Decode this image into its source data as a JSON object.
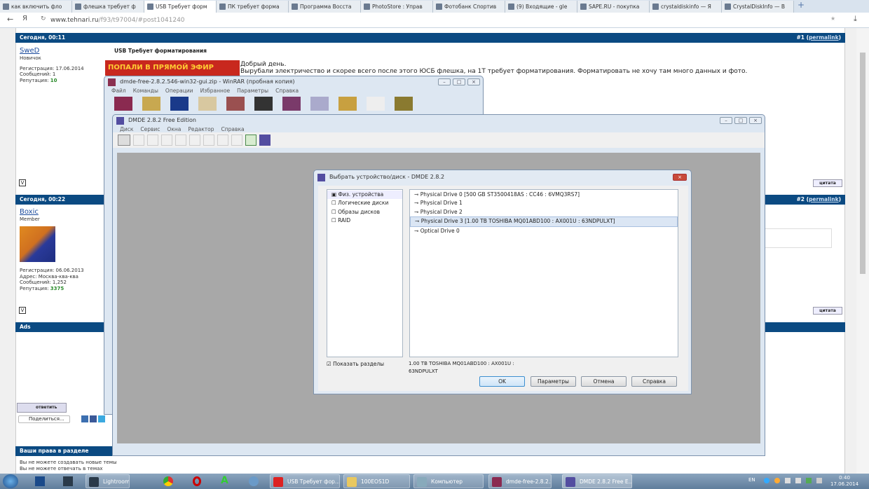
{
  "browser": {
    "tabs": [
      {
        "label": "как включить фло"
      },
      {
        "label": "флешка требует ф"
      },
      {
        "label": "USB Требует форм",
        "active": true
      },
      {
        "label": "ПК требует форма"
      },
      {
        "label": "Программа Восста"
      },
      {
        "label": "PhotoStore : Управ"
      },
      {
        "label": "Фотобанк Спортив"
      },
      {
        "label": "(9) Входящие - gle"
      },
      {
        "label": "SAPE.RU - покупка"
      },
      {
        "label": "crystaldiskinfo — Я"
      },
      {
        "label": "CrystalDiskInfo — В"
      }
    ],
    "url_host": "www.tehnari.ru",
    "url_path": "/f93/t97004/#post1041240"
  },
  "forum": {
    "post1": {
      "date": "Сегодня, 00:11",
      "number": "#1",
      "permalink": "permalink",
      "user": "SweD",
      "rank": "Новичок",
      "reg": "Регистрация: 17.06.2014",
      "posts": "Сообщений: 1",
      "rep_label": "Репутация:",
      "rep": "10",
      "title": "USB Требует форматирования",
      "banner": "ПОПАЛИ В ПРЯМОЙ ЭФИР",
      "text1": "Добрый день.",
      "text2": "Вырубали электричество и скорее всего после этого ЮСБ флешка, на 1Т требует форматирования. Форматировать не хочу там много данных и фото.",
      "quote": "цитата"
    },
    "post2": {
      "date": "Сегодня, 00:22",
      "number": "#2",
      "permalink": "permalink",
      "user": "Boxic",
      "rank": "Member",
      "reg": "Регистрация: 06.06.2013",
      "addr": "Адрес: Москва-ква-ква",
      "posts": "Сообщений: 1,252",
      "rep_label": "Репутация:",
      "rep": "3375",
      "quote": "цитата"
    },
    "ads": "Ads",
    "reply": "ответить",
    "share": "Поделиться...",
    "rights_title": "Ваши права в разделе",
    "rights": [
      "Вы не можете создавать новые темы",
      "Вы не можете отвечать в темах"
    ]
  },
  "winrar": {
    "title": "dmde-free-2.8.2.546-win32-gui.zip - WinRAR (пробная копия)",
    "menu": [
      "Файл",
      "Команды",
      "Операции",
      "Избранное",
      "Параметры",
      "Справка"
    ]
  },
  "dmde": {
    "title": "DMDE 2.8.2 Free Edition",
    "menu": [
      "Диск",
      "Сервис",
      "Окна",
      "Редактор",
      "Справка"
    ]
  },
  "dialog": {
    "title": "Выбрать устройство/диск - DMDE 2.8.2",
    "categories": [
      {
        "label": "Физ. устройства",
        "checked": true
      },
      {
        "label": "Логические диски",
        "checked": false
      },
      {
        "label": "Образы дисков",
        "checked": false
      },
      {
        "label": "RAID",
        "checked": false
      }
    ],
    "drives": [
      {
        "label": "Physical Drive 0 [500 GB ST3500418AS : CC46 : 6VMQ3RS7]"
      },
      {
        "label": "Physical Drive 1"
      },
      {
        "label": "Physical Drive 2"
      },
      {
        "label": "Physical Drive 3 [1.00 TB TOSHIBA MQ01ABD100 : AX001U : 63NDPULXT]",
        "selected": true
      },
      {
        "label": "Optical Drive 0"
      }
    ],
    "show_partitions": "Показать разделы",
    "info1": "1.00 TB TOSHIBA MQ01ABD100 : AX001U :",
    "info2": "63NDPULXT",
    "ok": "OK",
    "params": "Параметры",
    "cancel": "Отмена",
    "help": "Справка"
  },
  "taskbar": {
    "items": [
      "Lightroom 3 Catal...",
      "USB Требует фор...",
      "100EOS1D",
      "Компьютер",
      "dmde-free-2.8.2.5...",
      "DMDE 2.8.2 Free E..."
    ],
    "lang": "EN",
    "time": "0:40",
    "date": "17.06.2014"
  },
  "colors": {
    "forum_header": "#0b4a82",
    "taskbar": "#6f8cab",
    "dmde_client": "#a8a8a8"
  }
}
